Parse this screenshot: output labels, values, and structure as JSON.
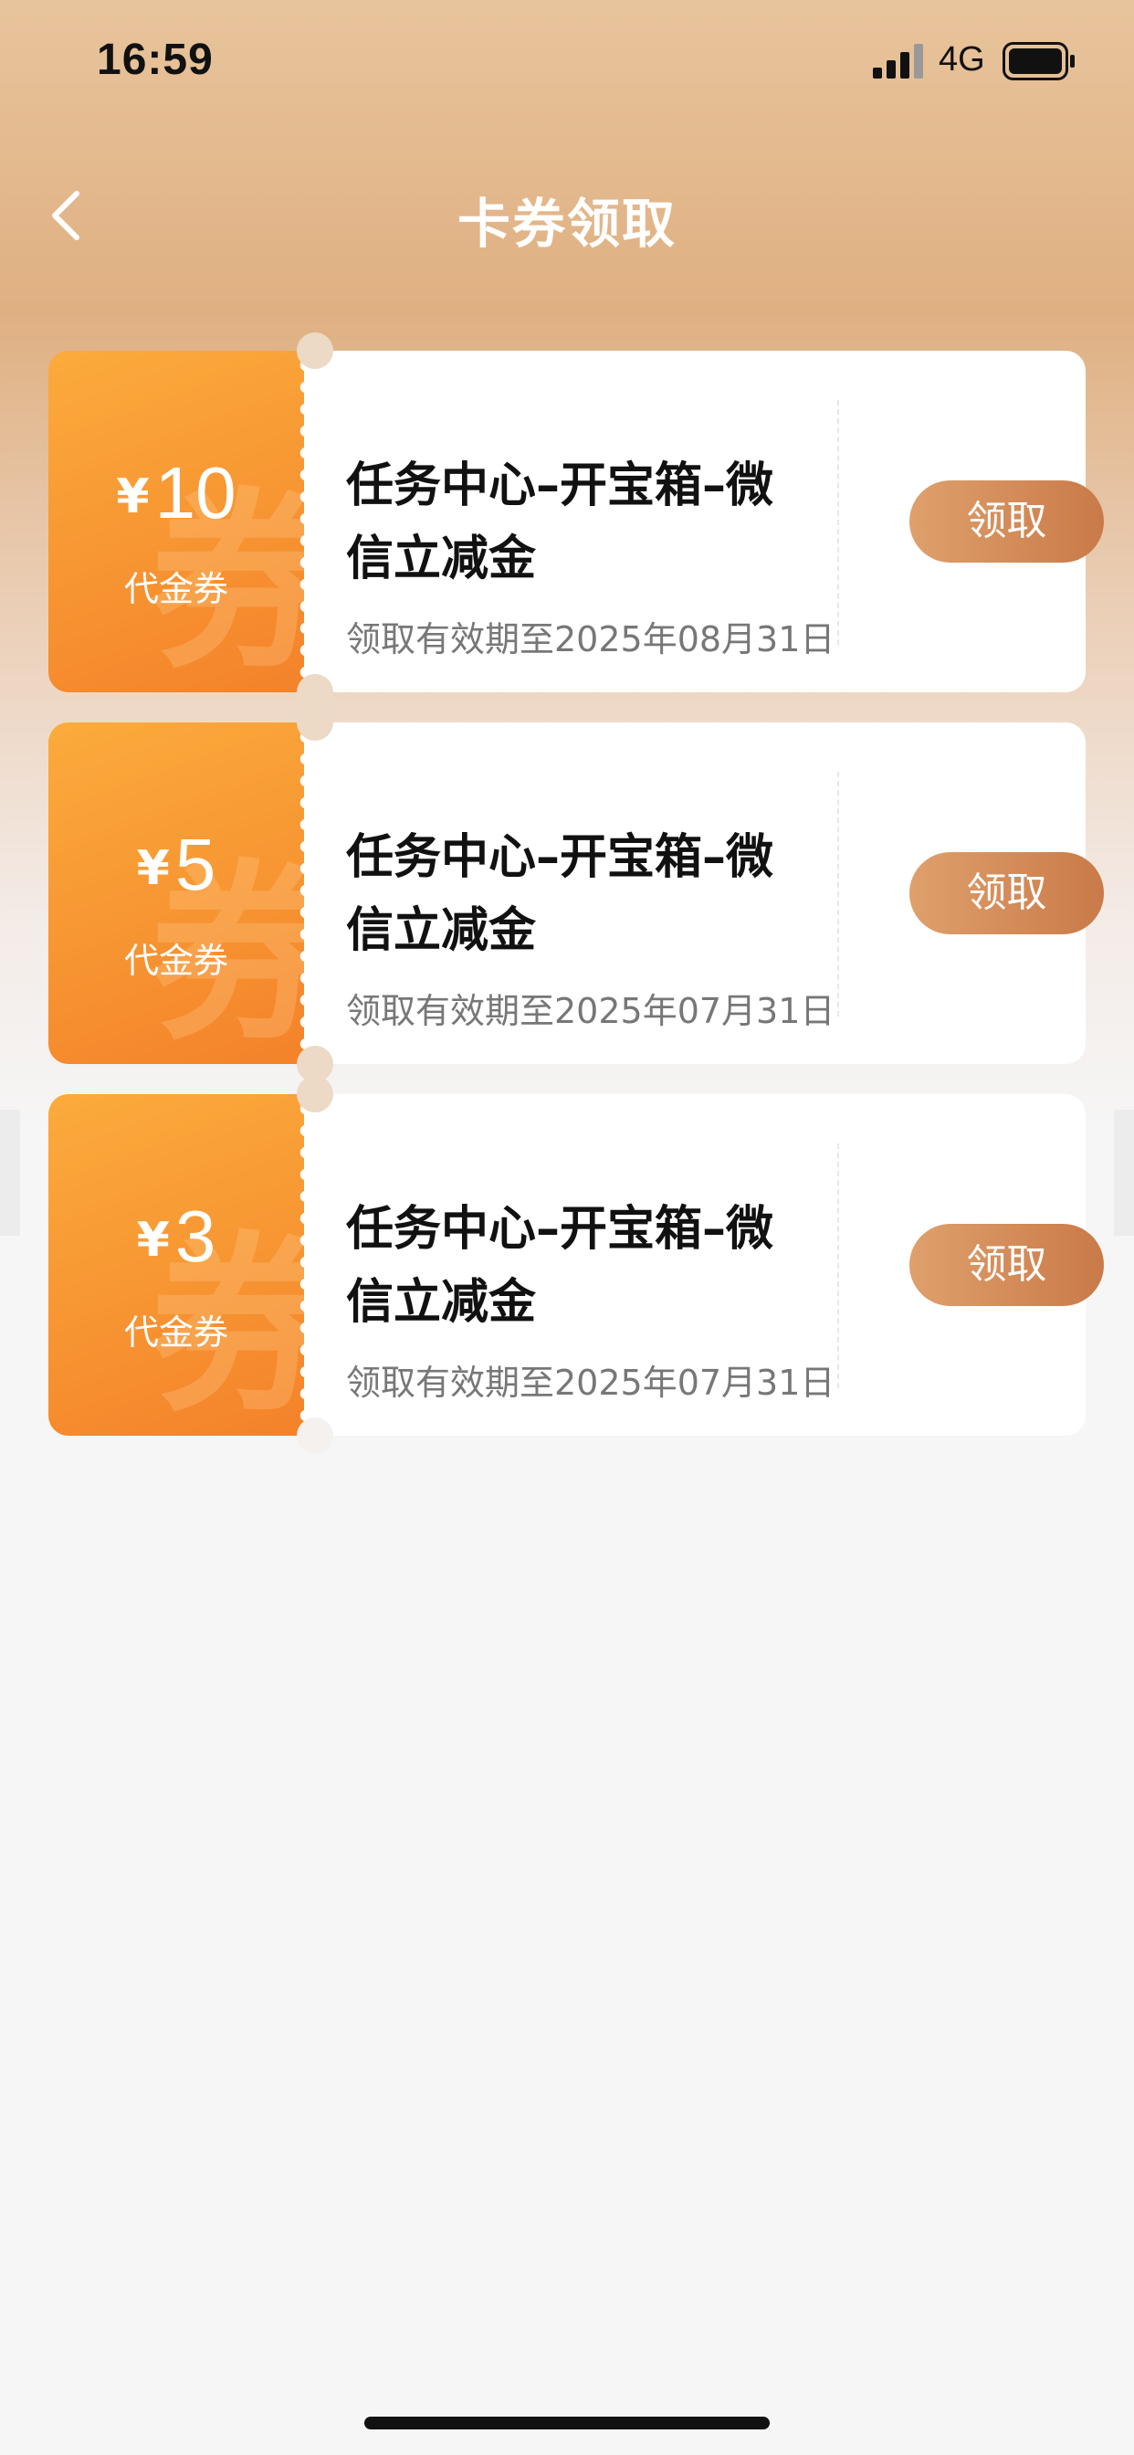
{
  "status_bar": {
    "time": "16:59",
    "network": "4G"
  },
  "nav": {
    "title": "卡券领取"
  },
  "coupons": [
    {
      "currency": "¥",
      "amount": "10",
      "type": "代金券",
      "watermark": "券",
      "title_line1": "任务中心–开宝箱–微",
      "title_line2": "信立减金",
      "expiry": "领取有效期至2025年08月31日",
      "button": "领取"
    },
    {
      "currency": "¥",
      "amount": "5",
      "type": "代金券",
      "watermark": "券",
      "title_line1": "任务中心–开宝箱–微",
      "title_line2": "信立减金",
      "expiry": "领取有效期至2025年07月31日",
      "button": "领取"
    },
    {
      "currency": "¥",
      "amount": "3",
      "type": "代金券",
      "watermark": "券",
      "title_line1": "任务中心–开宝箱–微",
      "title_line2": "信立减金",
      "expiry": "领取有效期至2025年07月31日",
      "button": "领取"
    }
  ],
  "colors": {
    "coupon_orange": "#f79532",
    "button_brown": "#d08b58",
    "header_tan": "#dfb082"
  }
}
